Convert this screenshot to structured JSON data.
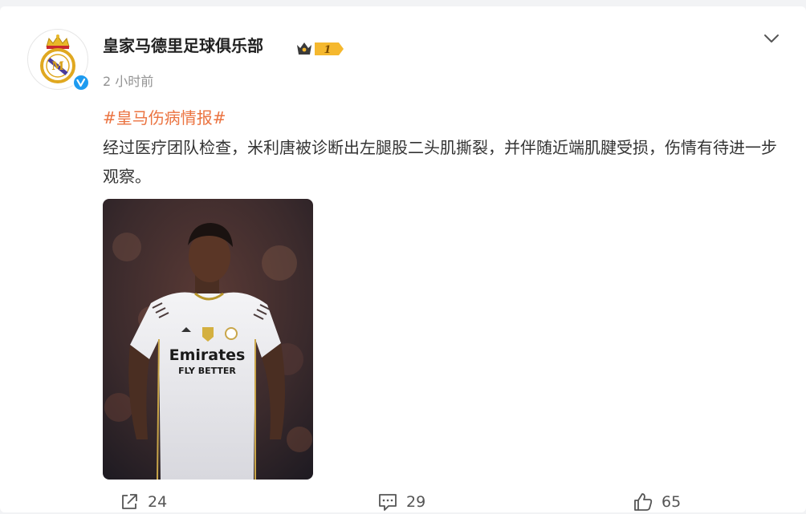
{
  "post": {
    "author": "皇家马德里足球俱乐部",
    "vip_level": "1",
    "timestamp": "2 小时前",
    "topic": "#皇马伤病情报#",
    "text": "经过医疗团队检查，米利唐被诊断出左腿股二头肌撕裂，并伴随近端肌腱受损，伤情有待进一步观察。",
    "image": {
      "sponsor_line1": "Emirates",
      "sponsor_line2": "FLY BETTER"
    }
  },
  "actions": {
    "share_count": "24",
    "comment_count": "29",
    "like_count": "65"
  },
  "colors": {
    "topic": "#eb7340",
    "verified": "#1e9bf0",
    "vip_gold": "#f5b82e",
    "muted": "#939393"
  },
  "icons": [
    "real-madrid-crest-icon",
    "verified-icon",
    "vip-crown-icon",
    "chevron-down-icon",
    "share-icon",
    "comment-icon",
    "like-icon"
  ]
}
